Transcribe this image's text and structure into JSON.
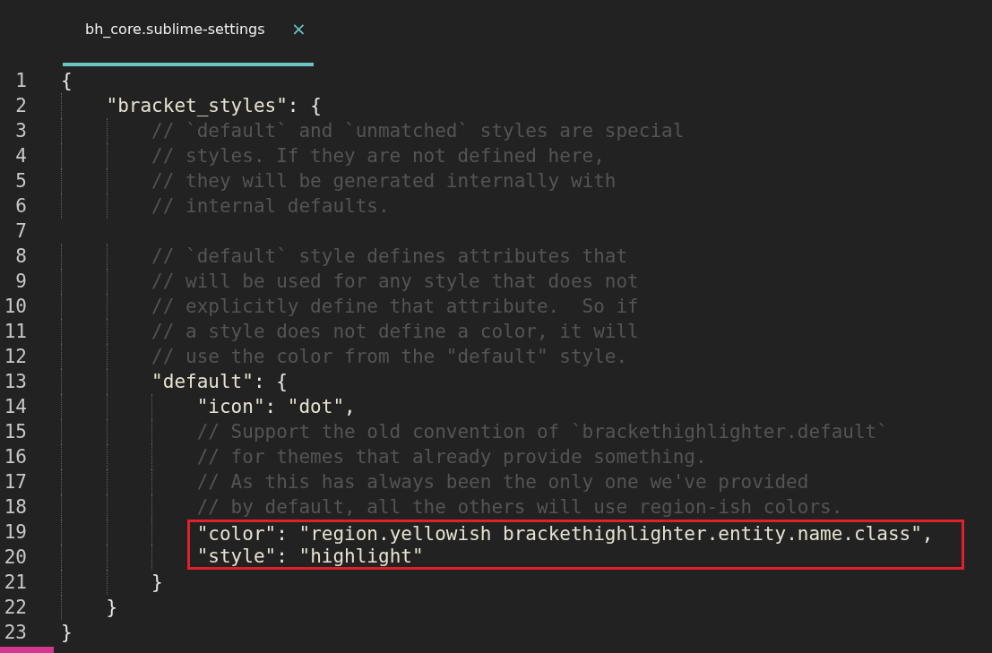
{
  "tabs": [
    {
      "label": "bh_core.sublime-settings",
      "close": "×",
      "selected": true
    }
  ],
  "lines": [
    {
      "number": "1",
      "tokens": [
        {
          "kind": "punct",
          "text": "{"
        }
      ],
      "children": [
        {
          "number": "2",
          "tokens": [
            {
              "kind": "key",
              "text": "\"bracket_styles\""
            },
            {
              "kind": "punct",
              "text": ": {"
            }
          ],
          "children": [
            {
              "number": "3",
              "tokens": [
                {
                  "kind": "comment",
                  "text": "// `default` and `unmatched` styles are special"
                }
              ]
            },
            {
              "number": "4",
              "tokens": [
                {
                  "kind": "comment",
                  "text": "// styles. If they are not defined here,"
                }
              ]
            },
            {
              "number": "5",
              "tokens": [
                {
                  "kind": "comment",
                  "text": "// they will be generated internally with"
                }
              ]
            },
            {
              "number": "6",
              "tokens": [
                {
                  "kind": "comment",
                  "text": "// internal defaults."
                }
              ]
            },
            {
              "number": "7"
            },
            {
              "number": "8",
              "tokens": [
                {
                  "kind": "comment",
                  "text": "// `default` style defines attributes that"
                }
              ]
            },
            {
              "number": "9",
              "tokens": [
                {
                  "kind": "comment",
                  "text": "// will be used for any style that does not"
                }
              ]
            },
            {
              "number": "10",
              "tokens": [
                {
                  "kind": "comment",
                  "text": "// explicitly define that attribute.  So if"
                }
              ]
            },
            {
              "number": "11",
              "tokens": [
                {
                  "kind": "comment",
                  "text": "// a style does not define a color, it will"
                }
              ]
            },
            {
              "number": "12",
              "tokens": [
                {
                  "kind": "comment",
                  "text": "// use the color from the \"default\" style."
                }
              ]
            },
            {
              "number": "13",
              "tokens": [
                {
                  "kind": "key",
                  "text": "\"default\""
                },
                {
                  "kind": "punct",
                  "text": ": {"
                }
              ],
              "children": [
                {
                  "number": "14",
                  "tokens": [
                    {
                      "kind": "key",
                      "text": "\"icon\""
                    },
                    {
                      "kind": "punct",
                      "text": ": "
                    },
                    {
                      "kind": "string",
                      "text": "\"dot\""
                    },
                    {
                      "kind": "punct",
                      "text": ","
                    }
                  ]
                },
                {
                  "number": "15",
                  "tokens": [
                    {
                      "kind": "comment",
                      "text": "// Support the old convention of `brackethighlighter.default`"
                    }
                  ]
                },
                {
                  "number": "16",
                  "tokens": [
                    {
                      "kind": "comment",
                      "text": "// for themes that already provide something."
                    }
                  ]
                },
                {
                  "number": "17",
                  "tokens": [
                    {
                      "kind": "comment",
                      "text": "// As this has always been the only one we've provided"
                    }
                  ]
                },
                {
                  "number": "18",
                  "tokens": [
                    {
                      "kind": "comment",
                      "text": "// by default, all the others will use region-ish colors."
                    }
                  ]
                },
                {
                  "number": "19",
                  "boxed": true,
                  "tokens": [
                    {
                      "kind": "key",
                      "text": "\"color\""
                    },
                    {
                      "kind": "punct",
                      "text": ": "
                    },
                    {
                      "kind": "string",
                      "text": "\"region.yellowish brackethighlighter.entity.name.class\""
                    },
                    {
                      "kind": "punct",
                      "text": ","
                    }
                  ]
                },
                {
                  "number": "20",
                  "boxed": true,
                  "tokens": [
                    {
                      "kind": "key",
                      "text": "\"style\""
                    },
                    {
                      "kind": "punct",
                      "text": ": "
                    },
                    {
                      "kind": "string",
                      "text": "\"highlight\""
                    }
                  ]
                }
              ]
            },
            {
              "number": "21",
              "tokens": [
                {
                  "kind": "punct",
                  "text": "}"
                }
              ]
            }
          ]
        },
        {
          "number": "22",
          "tokens": [
            {
              "kind": "punct",
              "text": "}"
            }
          ]
        }
      ]
    },
    {
      "number": "23",
      "tokens": [
        {
          "kind": "punct",
          "text": "}"
        }
      ]
    }
  ]
}
